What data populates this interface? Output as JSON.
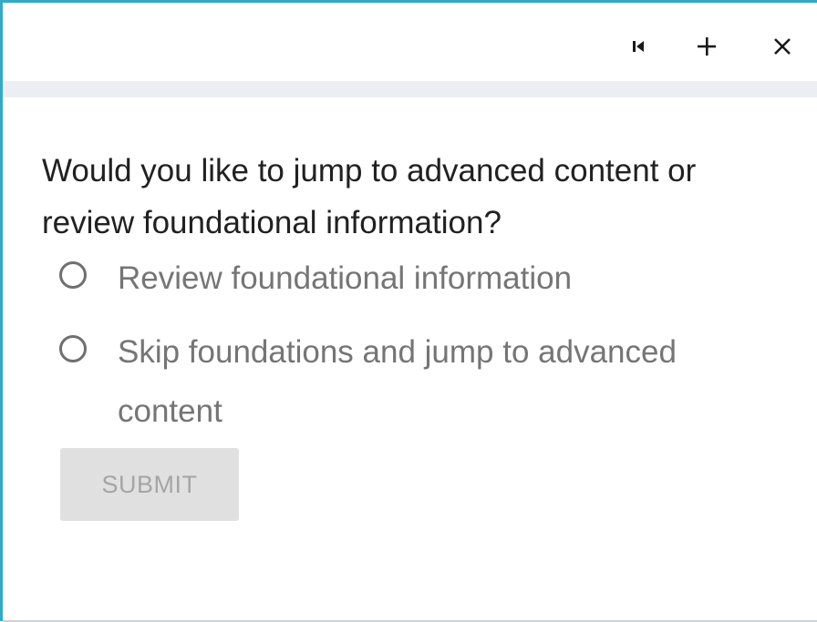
{
  "toolbar": {
    "icons": [
      "skip-to-start-icon",
      "add-icon",
      "close-icon"
    ]
  },
  "question": {
    "text": "Would you like to jump to advanced content or review foundational information?"
  },
  "options": [
    {
      "label": "Review foundational information",
      "selected": false
    },
    {
      "label": "Skip foundations and jump to advanced content",
      "selected": false
    }
  ],
  "submit": {
    "label": "SUBMIT",
    "enabled": false
  },
  "colors": {
    "border_accent": "#35a9bf",
    "toolbar_strip": "#ebeef2",
    "question_text": "#212121",
    "option_text": "#757575",
    "button_bg_disabled": "#e0e0e0",
    "button_text_disabled": "#a5a5a5"
  }
}
